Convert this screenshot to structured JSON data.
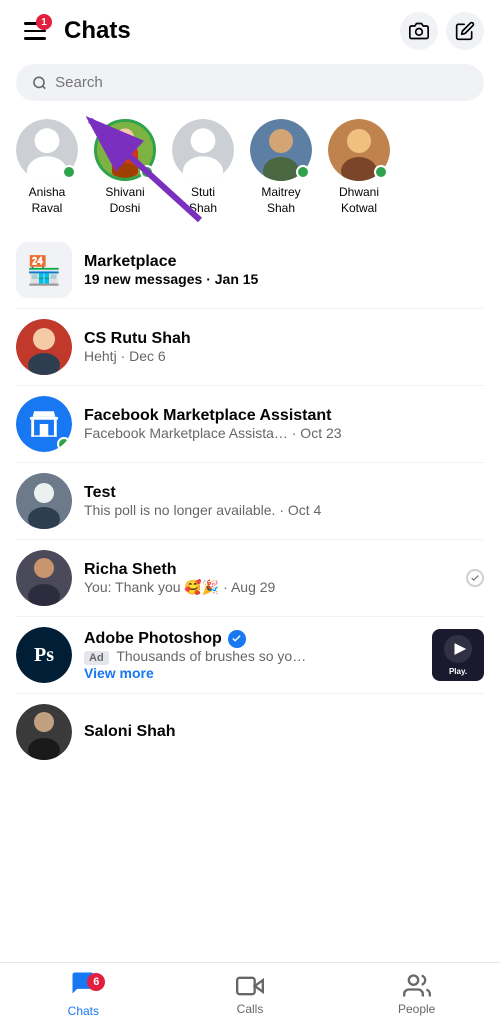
{
  "header": {
    "title": "Chats",
    "notification_count": "1",
    "camera_label": "camera",
    "compose_label": "compose"
  },
  "search": {
    "placeholder": "Search"
  },
  "stories": [
    {
      "name": "Anisha\nRaval",
      "online": true,
      "type": "placeholder"
    },
    {
      "name": "Shivani\nDoshi",
      "online": true,
      "type": "shivani"
    },
    {
      "name": "Stuti\nShah",
      "online": false,
      "type": "placeholder"
    },
    {
      "name": "Maitrey\nShah",
      "online": true,
      "type": "maitrey"
    },
    {
      "name": "Dhwani\nKotwal",
      "online": true,
      "type": "dhwani"
    }
  ],
  "chats": [
    {
      "id": "marketplace",
      "name": "Marketplace",
      "preview": "19 new messages",
      "time": "Jan 15",
      "unread": true,
      "avatar_type": "marketplace"
    },
    {
      "id": "cs-rutu",
      "name": "CS Rutu Shah",
      "preview": "Hehtj · Dec 6",
      "time": "",
      "unread": false,
      "avatar_type": "cs"
    },
    {
      "id": "fb-marketplace",
      "name": "Facebook Marketplace Assistant",
      "preview": "Facebook Marketplace Assista… · Oct 23",
      "time": "",
      "unread": false,
      "avatar_type": "fb",
      "online": true
    },
    {
      "id": "test",
      "name": "Test",
      "preview": "This poll is no longer available. · Oct 4",
      "time": "",
      "unread": false,
      "avatar_type": "test"
    },
    {
      "id": "richa",
      "name": "Richa Sheth",
      "preview": "You: Thank you 🥰🎉 · Aug 29",
      "time": "",
      "unread": false,
      "avatar_type": "richa",
      "read_receipt": true
    },
    {
      "id": "adobe",
      "name": "Adobe Photoshop",
      "preview_ad": true,
      "preview_text": "Thousands of brushes so yo…",
      "time": "",
      "unread": false,
      "avatar_type": "adobe",
      "verified": true,
      "has_thumb": true
    },
    {
      "id": "saloni",
      "name": "Saloni Shah",
      "preview": "",
      "time": "",
      "unread": false,
      "avatar_type": "saloni"
    }
  ],
  "bottom_nav": {
    "chats": {
      "label": "Chats",
      "badge": "6",
      "active": true
    },
    "calls": {
      "label": "Calls",
      "active": false
    },
    "people": {
      "label": "People",
      "active": false
    }
  }
}
